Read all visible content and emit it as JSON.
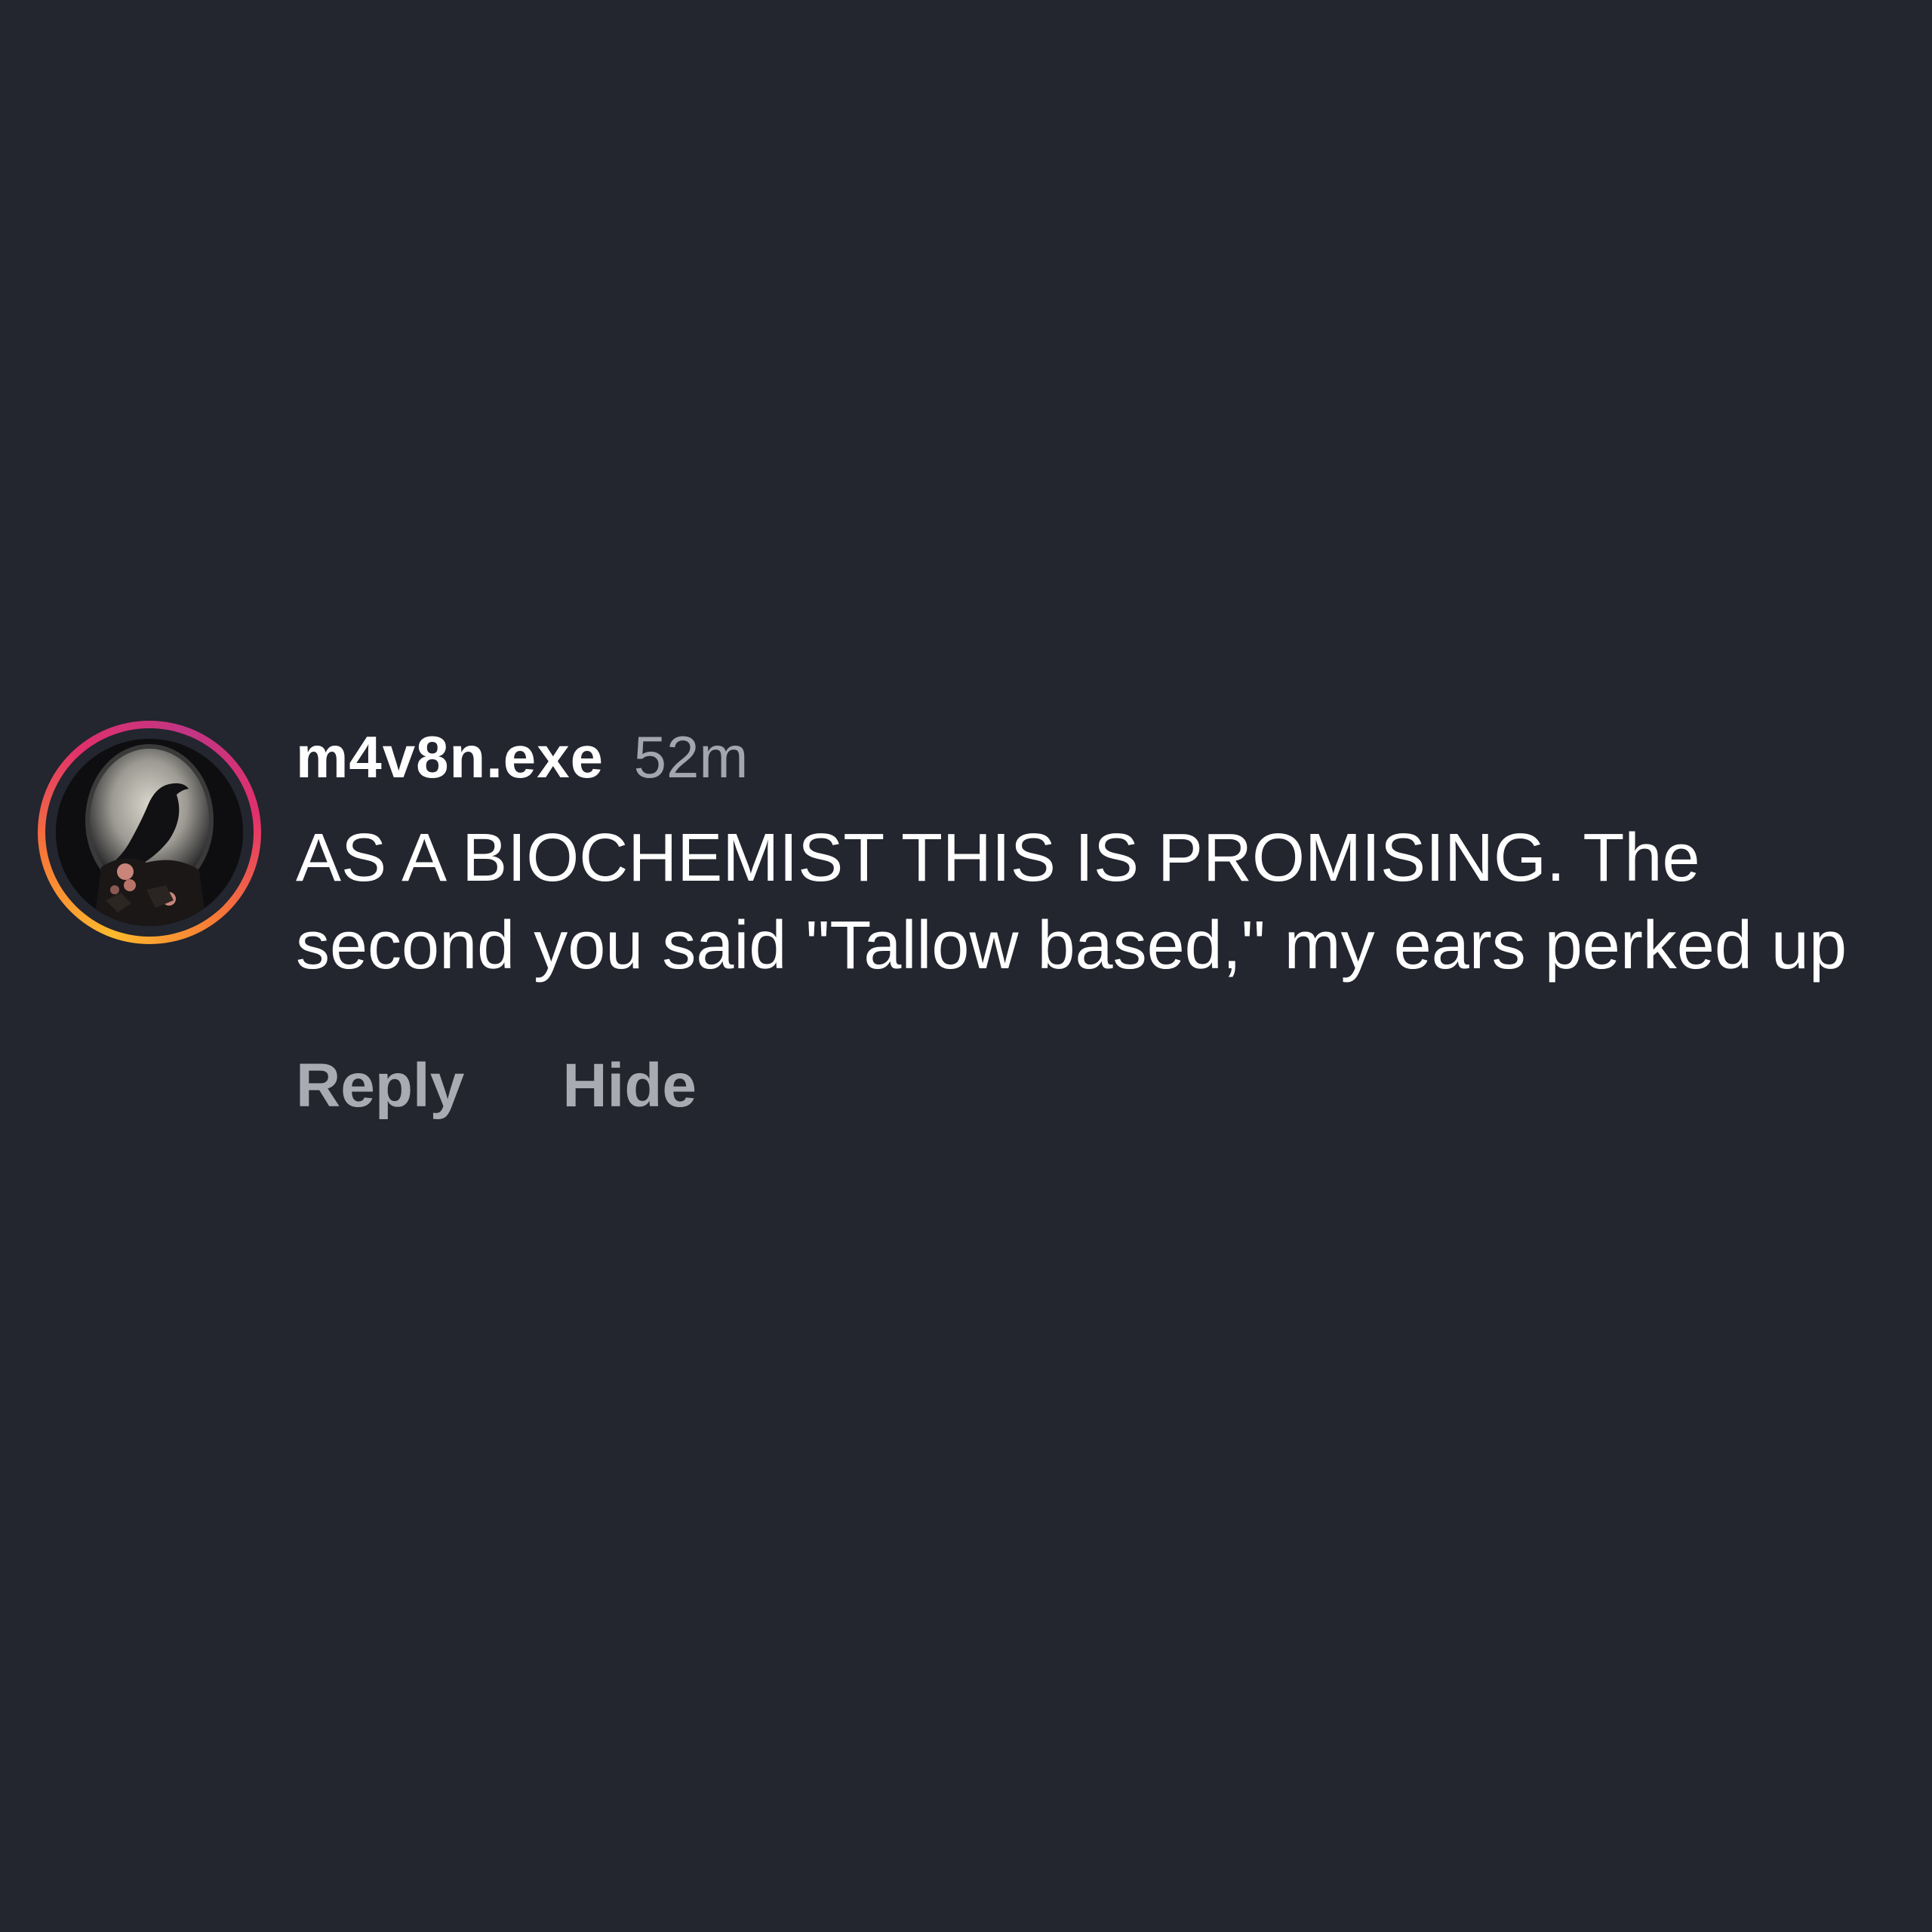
{
  "comment": {
    "username": "m4v8n.exe",
    "timestamp": "52m",
    "text": "AS A BIOCHEMIST THIS IS PROMISING. The second you said \"Tallow based,\" my ears perked up",
    "avatar_icon": "raven-avatar-icon",
    "actions": {
      "reply_label": "Reply",
      "hide_label": "Hide"
    }
  },
  "colors": {
    "background": "#23252f",
    "text_primary": "#ffffff",
    "text_secondary": "#a3a6ae",
    "story_ring_gradient": [
      "#fdbb2d",
      "#f77737",
      "#e1306c",
      "#c13584"
    ]
  }
}
